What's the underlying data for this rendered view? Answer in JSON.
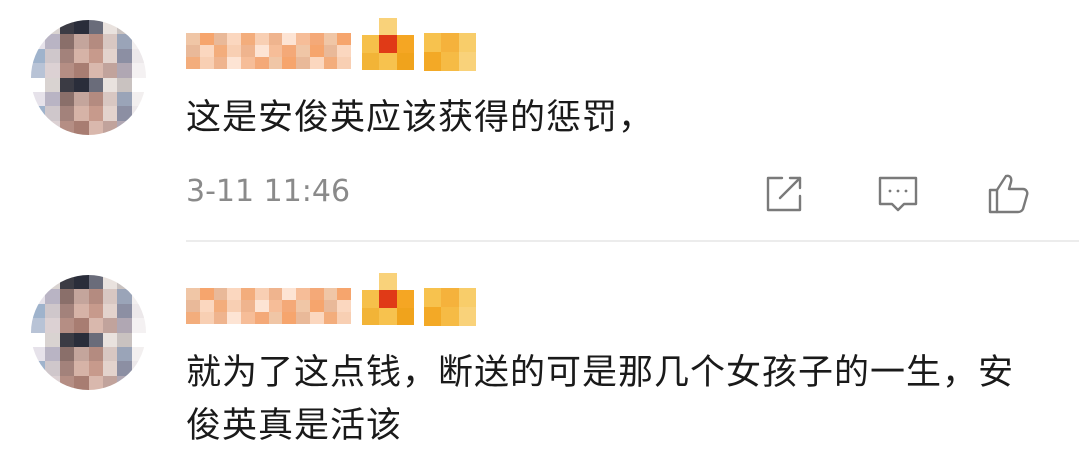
{
  "comments": [
    {
      "username": "",
      "text": "这是安俊英应该获得的惩罚，",
      "timestamp": "3-11 11:46",
      "actions": {
        "forward_icon": "share-edit-icon",
        "comment_icon": "comment-bubble-icon",
        "like_icon": "thumbs-up-icon"
      }
    },
    {
      "username": "",
      "text": "就为了这点钱，断送的可是那几个女孩子的一生，安俊英真是活该"
    }
  ],
  "colors": {
    "text": "#1a1a1a",
    "meta": "#8a8a8a",
    "icon": "#7a7a7a",
    "divider": "#ececec",
    "badge_orange": "#f5a623",
    "badge_red": "#e03a17"
  }
}
